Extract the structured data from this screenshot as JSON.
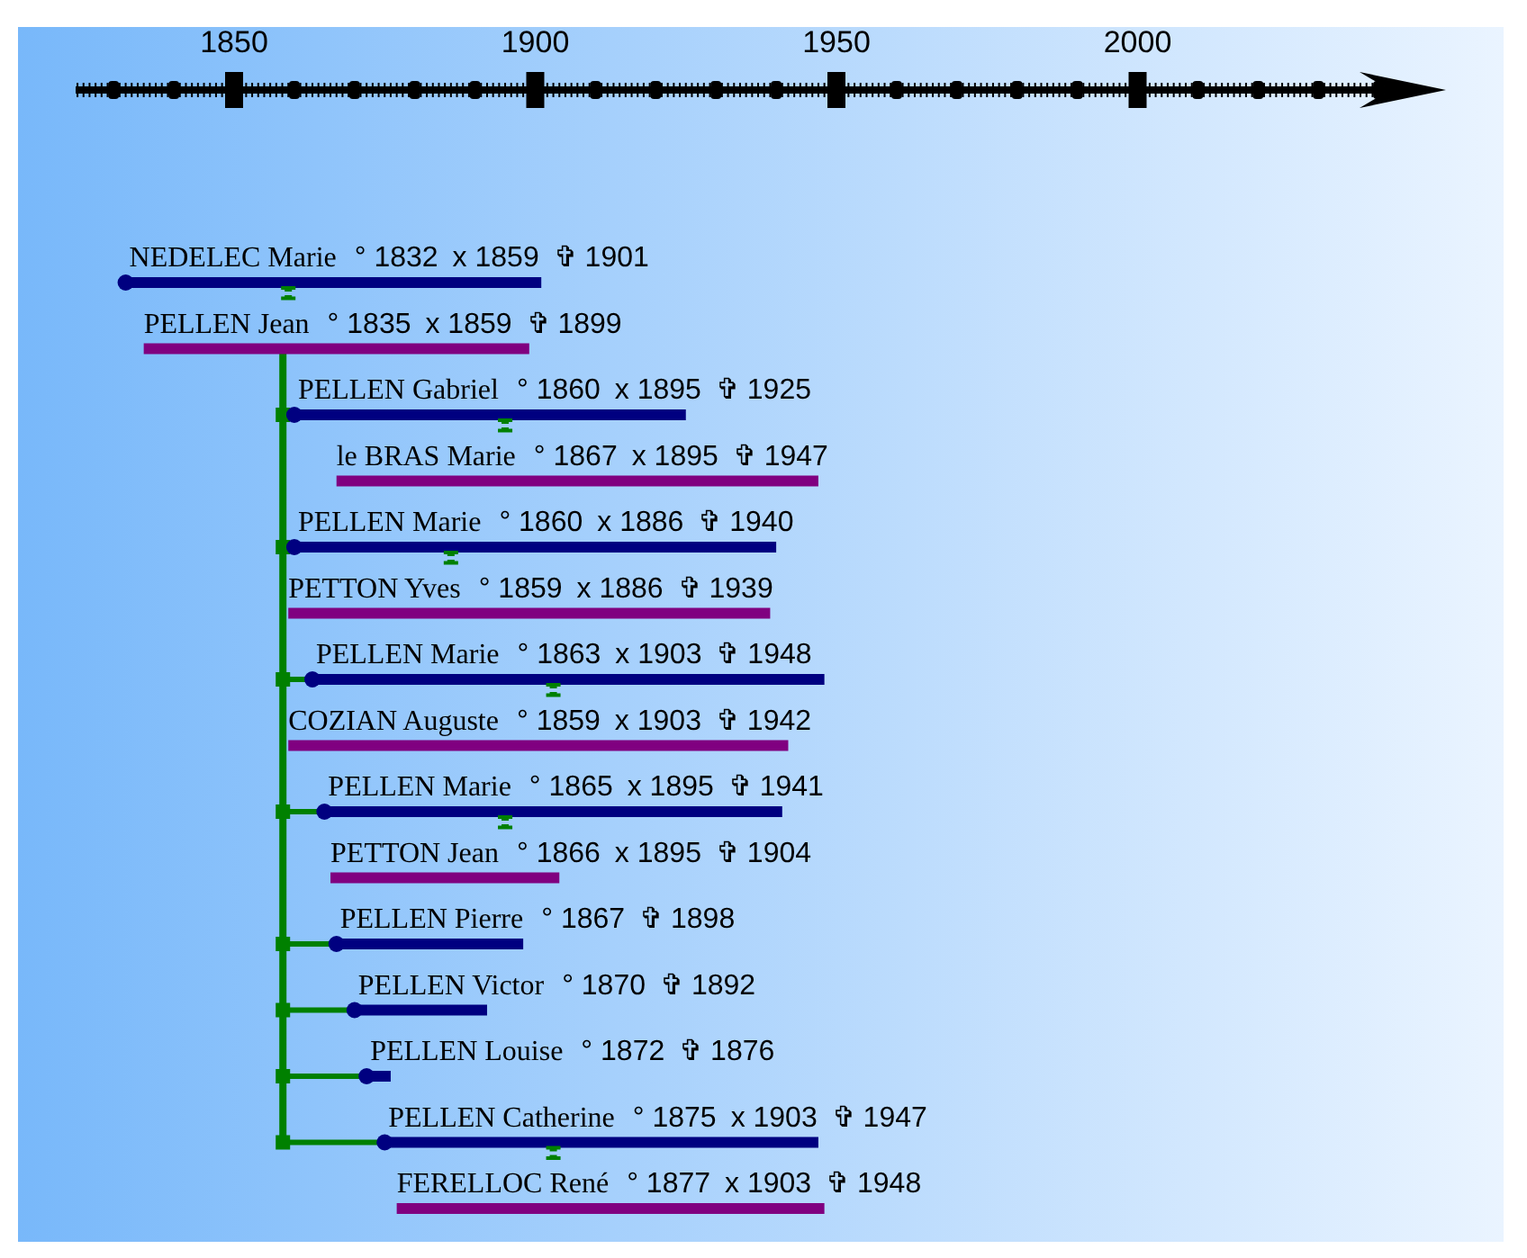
{
  "axis": {
    "ticks": [
      {
        "label": "1850"
      },
      {
        "label": "1900"
      },
      {
        "label": "1950"
      },
      {
        "label": "2000"
      }
    ]
  },
  "family": {
    "person": {
      "name": "NEDELEC Marie",
      "birth": "° 1832",
      "marriage": "x 1859",
      "death": "✞ 1901"
    },
    "spouse": {
      "name": "PELLEN Jean",
      "birth": "° 1835",
      "marriage": "x 1859",
      "death": "✞ 1899"
    },
    "children": [
      {
        "person": {
          "name": "PELLEN Gabriel",
          "birth": "° 1860",
          "marriage": "x 1895",
          "death": "✞ 1925"
        },
        "spouse": {
          "name": "le BRAS Marie",
          "birth": "° 1867",
          "marriage": "x 1895",
          "death": "✞ 1947"
        }
      },
      {
        "person": {
          "name": "PELLEN Marie",
          "birth": "° 1860",
          "marriage": "x 1886",
          "death": "✞ 1940"
        },
        "spouse": {
          "name": "PETTON Yves",
          "birth": "° 1859",
          "marriage": "x 1886",
          "death": "✞ 1939"
        }
      },
      {
        "person": {
          "name": "PELLEN Marie",
          "birth": "° 1863",
          "marriage": "x 1903",
          "death": "✞ 1948"
        },
        "spouse": {
          "name": "COZIAN Auguste",
          "birth": "° 1859",
          "marriage": "x 1903",
          "death": "✞ 1942"
        }
      },
      {
        "person": {
          "name": "PELLEN Marie",
          "birth": "° 1865",
          "marriage": "x 1895",
          "death": "✞ 1941"
        },
        "spouse": {
          "name": "PETTON Jean",
          "birth": "° 1866",
          "marriage": "x 1895",
          "death": "✞ 1904"
        }
      },
      {
        "person": {
          "name": "PELLEN Pierre",
          "birth": "° 1867",
          "death": "✞ 1898"
        }
      },
      {
        "person": {
          "name": "PELLEN Victor",
          "birth": "° 1870",
          "death": "✞ 1892"
        }
      },
      {
        "person": {
          "name": "PELLEN Louise",
          "birth": "° 1872",
          "death": "✞ 1876"
        }
      },
      {
        "person": {
          "name": "PELLEN Catherine",
          "birth": "° 1875",
          "marriage": "x 1903",
          "death": "✞ 1947"
        },
        "spouse": {
          "name": "FERELLOC René",
          "birth": "° 1877",
          "marriage": "x 1903",
          "death": "✞ 1948"
        }
      }
    ]
  }
}
